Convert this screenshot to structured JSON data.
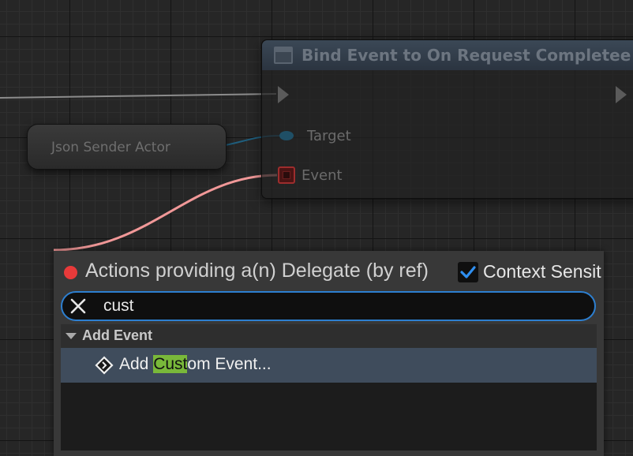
{
  "node": {
    "title": "Bind Event to On Request Completee",
    "target_label": "Target",
    "event_label": "Event"
  },
  "actor_node": {
    "label": "Json Sender Actor"
  },
  "action_menu": {
    "title": "Actions providing a(n) Delegate (by ref)",
    "context_label": "Context Sensit",
    "context_checked": true,
    "search_value": "cust",
    "category": "Add Event",
    "item_prefix": "Add ",
    "item_match": "Cust",
    "item_suffix": "om Event..."
  },
  "icons": {
    "node": "function-node-icon",
    "status": "red-dot-icon",
    "check": "checkmark-icon",
    "clear": "close-icon",
    "category": "triangle-down-icon",
    "item": "event-diamond-icon"
  },
  "colors": {
    "accent": "#2d7fd0",
    "highlight": "#79b83a",
    "delegate_wire": "#f19898",
    "dot": "#e83a3a"
  }
}
